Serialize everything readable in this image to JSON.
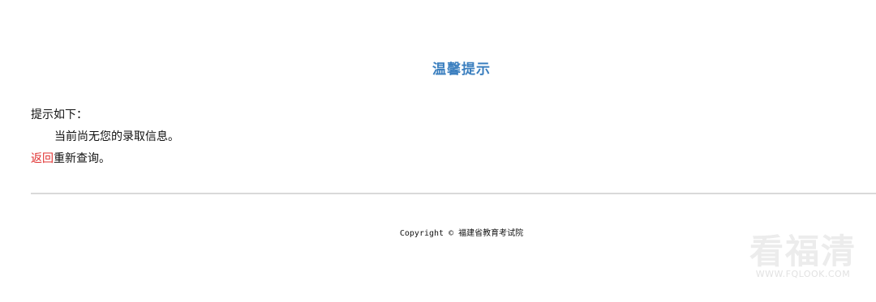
{
  "header": {
    "title": "温馨提示"
  },
  "message": {
    "intro": "提示如下：",
    "detail": "当前尚无您的录取信息。",
    "back_link": "返回",
    "back_suffix": "重新查询。"
  },
  "footer": {
    "copyright": "Copyright © 福建省教育考试院"
  },
  "watermark": {
    "text": "看福清",
    "url": "WWW.FQLOOK.COM"
  },
  "colors": {
    "title": "#3b7fbf",
    "link": "#e03030",
    "text": "#111111",
    "divider": "#d9d9d9"
  }
}
